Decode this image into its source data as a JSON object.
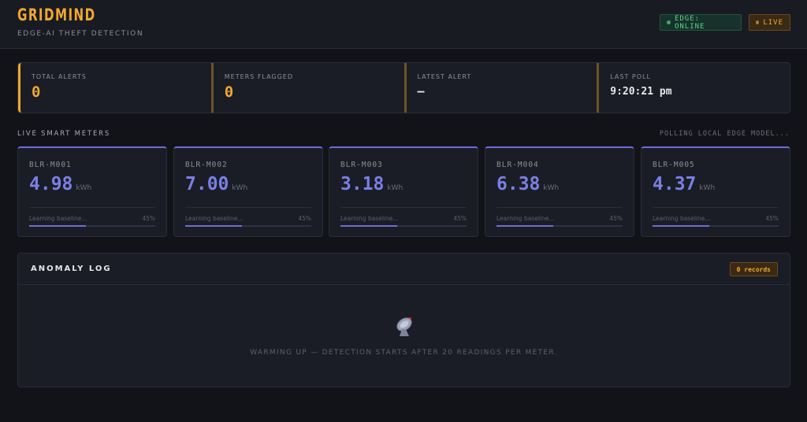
{
  "header": {
    "logo": "GRIDMIND",
    "tagline": "EDGE-AI THEFT DETECTION",
    "edge_badge": "EDGE: ONLINE",
    "live_badge": "LIVE"
  },
  "stats": [
    {
      "label": "TOTAL ALERTS",
      "value": "0"
    },
    {
      "label": "METERS FLAGGED",
      "value": "0"
    },
    {
      "label": "LATEST ALERT",
      "value": "—"
    },
    {
      "label": "LAST POLL",
      "value": "9:20:21 pm"
    }
  ],
  "meters_section": {
    "title": "LIVE SMART METERS",
    "status": "POLLING LOCAL EDGE MODEL..."
  },
  "meters": [
    {
      "id": "BLR-M001",
      "value": "4.98",
      "unit": "kWh",
      "status": "Learning baseline...",
      "pct_label": "45%",
      "progress": 0.45
    },
    {
      "id": "BLR-M002",
      "value": "7.00",
      "unit": "kWh",
      "status": "Learning baseline...",
      "pct_label": "45%",
      "progress": 0.45
    },
    {
      "id": "BLR-M003",
      "value": "3.18",
      "unit": "kWh",
      "status": "Learning baseline...",
      "pct_label": "45%",
      "progress": 0.45
    },
    {
      "id": "BLR-M004",
      "value": "6.38",
      "unit": "kWh",
      "status": "Learning baseline...",
      "pct_label": "45%",
      "progress": 0.45
    },
    {
      "id": "BLR-M005",
      "value": "4.37",
      "unit": "kWh",
      "status": "Learning baseline...",
      "pct_label": "45%",
      "progress": 0.45
    }
  ],
  "anomaly_log": {
    "title": "ANOMALY LOG",
    "count": "0 records",
    "icon": "satellite-dish-icon",
    "empty_message": "WARMING UP — DETECTION STARTS AFTER 20 READINGS PER METER."
  },
  "colors": {
    "accent": "#f0a830",
    "meter": "#7b7fe6",
    "online": "#5fd18e",
    "background": "#121318"
  }
}
